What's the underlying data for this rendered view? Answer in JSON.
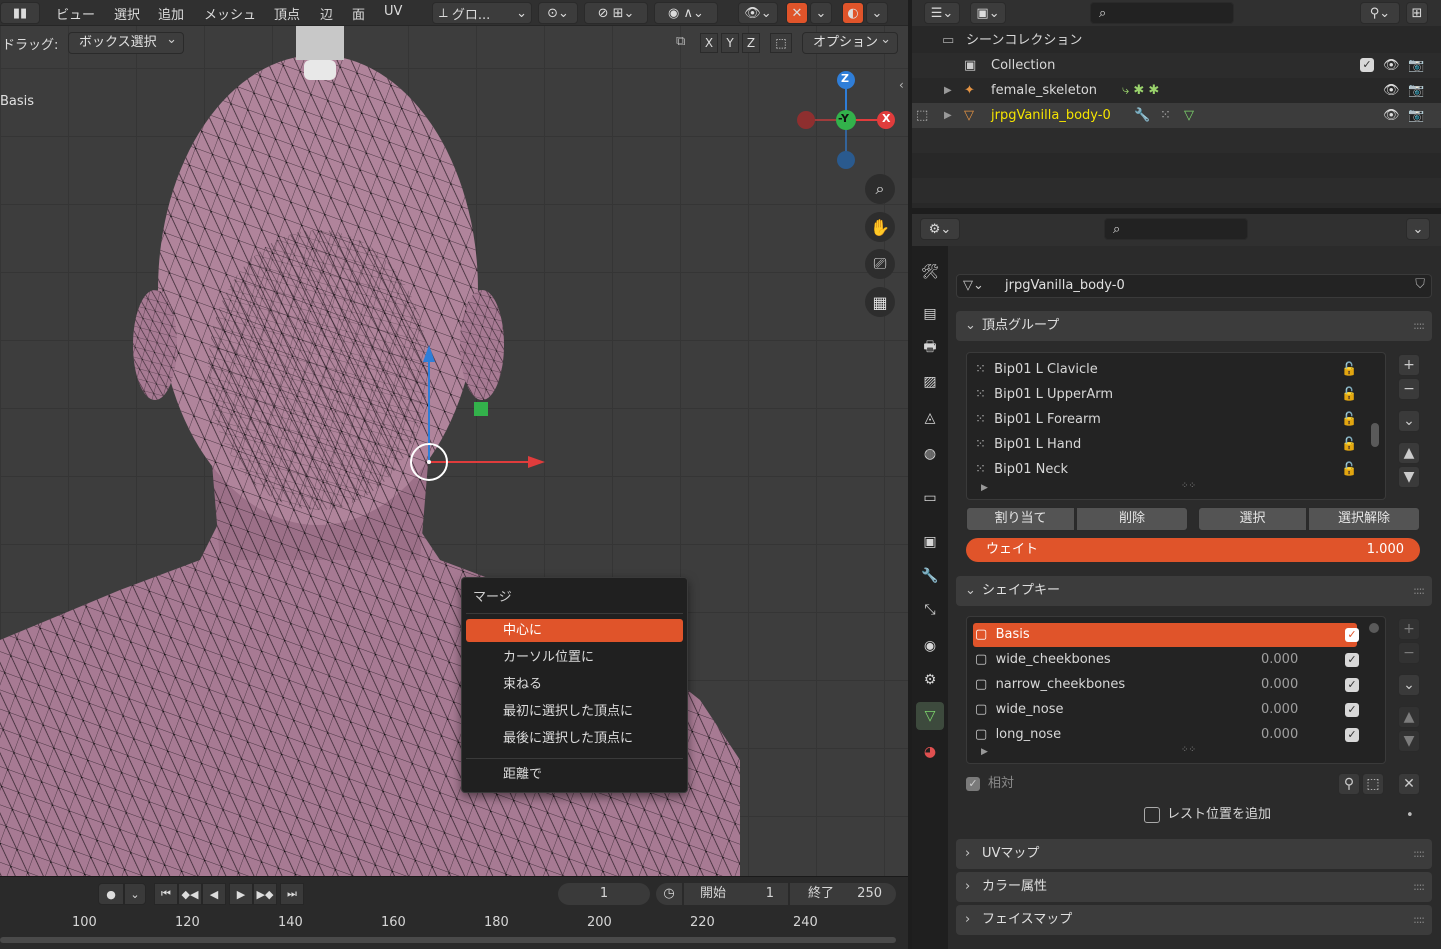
{
  "header": {
    "menus": [
      "ビュー",
      "選択",
      "追加",
      "メッシュ",
      "頂点",
      "辺",
      "面",
      "UV"
    ],
    "transform_orientation": "グロ...",
    "drag_label": "ドラッグ:",
    "drag_value": "ボックス選択",
    "options_label": "オプション",
    "axes": [
      "X",
      "Y",
      "Z"
    ]
  },
  "viewport": {
    "shape_key_overlay": "Basis",
    "gizmo_labels": {
      "z": "Z",
      "y": "-Y",
      "x": "X"
    }
  },
  "context_menu": {
    "title": "マージ",
    "items": [
      "中心に",
      "カーソル位置に",
      "束ねる",
      "最初に選択した頂点に",
      "最後に選択した頂点に"
    ],
    "extra_item": "距離で",
    "active_index": 0
  },
  "timeline": {
    "current_frame": "1",
    "start_label": "開始",
    "start_value": "1",
    "end_label": "終了",
    "end_value": "250",
    "ruler": [
      "100",
      "120",
      "140",
      "160",
      "180",
      "200",
      "220",
      "240"
    ]
  },
  "outliner": {
    "title": "シーンコレクション",
    "rows": [
      {
        "label": "Collection"
      },
      {
        "label": "female_skeleton"
      },
      {
        "label": "jrpgVanilla_body-0"
      }
    ]
  },
  "properties": {
    "object_name": "jrpgVanilla_body-0",
    "vertex_groups": {
      "title": "頂点グループ",
      "items": [
        "Bip01 L Clavicle",
        "Bip01 L UpperArm",
        "Bip01 L Forearm",
        "Bip01 L Hand",
        "Bip01 Neck"
      ],
      "buttons": {
        "assign": "割り当て",
        "remove": "削除",
        "select": "選択",
        "deselect": "選択解除"
      },
      "weight_label": "ウェイト",
      "weight_value": "1.000"
    },
    "shape_keys": {
      "title": "シェイプキー",
      "items": [
        {
          "name": "Basis",
          "value": ""
        },
        {
          "name": "wide_cheekbones",
          "value": "0.000"
        },
        {
          "name": "narrow_cheekbones",
          "value": "0.000"
        },
        {
          "name": "wide_nose",
          "value": "0.000"
        },
        {
          "name": "long_nose",
          "value": "0.000"
        }
      ],
      "relative_label": "相対",
      "rest_label": "レスト位置を追加"
    },
    "collapsed_panels": [
      "UVマップ",
      "カラー属性",
      "フェイスマップ"
    ]
  },
  "colors": {
    "accent": "#e0542a",
    "mesh": "#a77a93",
    "highlight_text": "#f5e400"
  }
}
